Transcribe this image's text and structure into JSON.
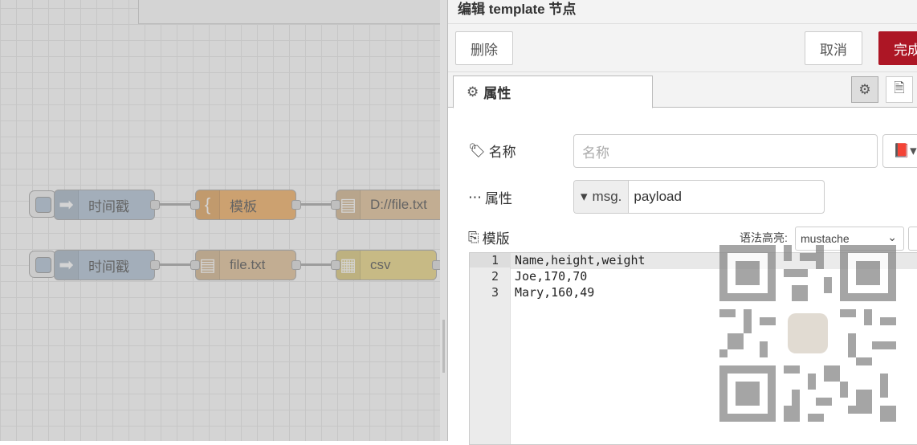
{
  "flow": {
    "row1": {
      "inject_label": "时间戳",
      "template_label": "模板",
      "file_label": "D://file.txt"
    },
    "row2": {
      "inject_label": "时间戳",
      "file_in_label": "file.txt",
      "csv_label": "csv"
    }
  },
  "colors": {
    "inject": "#a6bbcf",
    "template": "#f0a24a",
    "file": "#deb887",
    "csv": "#e8d070",
    "accent": "#ad1625"
  },
  "tray": {
    "title": "编辑 template 节点",
    "delete_label": "删除",
    "cancel_label": "取消",
    "done_label": "完成",
    "tab_properties": "属性",
    "name_label": "名称",
    "name_placeholder": "名称",
    "property_label": "属性",
    "property_type": "msg.",
    "property_value": "payload",
    "template_label": "模版",
    "syntax_label": "语法高亮:",
    "syntax_value": "mustache",
    "code_lines": [
      {
        "n": "1",
        "text": "Name,height,weight"
      },
      {
        "n": "2",
        "text": "Joe,170,70"
      },
      {
        "n": "3",
        "text": "Mary,160,49"
      }
    ]
  }
}
